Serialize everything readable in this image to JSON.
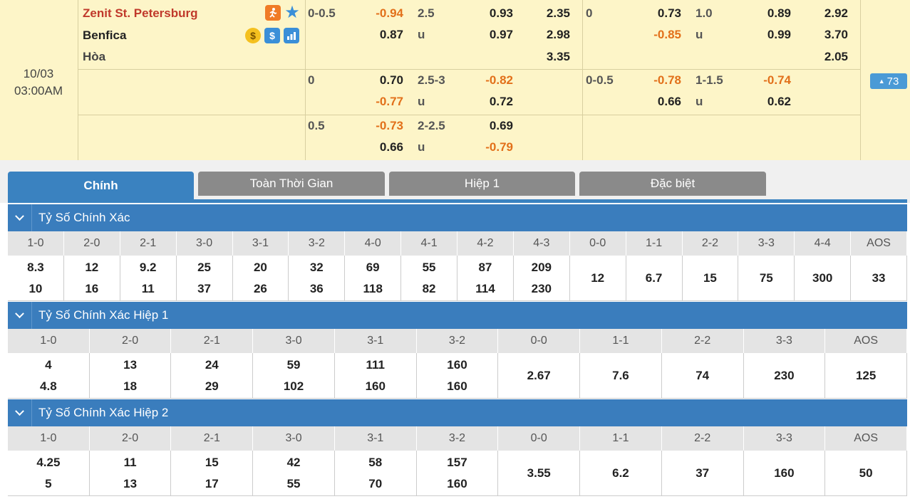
{
  "match": {
    "date": "10/03",
    "time": "03:00AM",
    "home": "Zenit St. Petersburg",
    "away": "Benfica",
    "draw": "Hòa",
    "more_count": "73",
    "icons": [
      "live-icon",
      "star-icon",
      "coin-icon",
      "dollar-icon",
      "stats-icon"
    ],
    "rows": [
      {
        "ft_hdp_line": "0-0.5",
        "ft_hdp_home": "-0.94",
        "ft_hdp_away": "0.87",
        "ft_ou_line": "2.5",
        "ft_ou_u": "u",
        "ft_ou_over": "0.93",
        "ft_ou_under": "0.97",
        "ft_1x2": [
          "2.35",
          "2.98",
          "3.35"
        ],
        "h1_hdp_line": "0",
        "h1_hdp_home": "0.73",
        "h1_hdp_away": "-0.85",
        "h1_ou_line": "1.0",
        "h1_ou_u": "u",
        "h1_ou_over": "0.89",
        "h1_ou_under": "0.99",
        "h1_1x2": [
          "2.92",
          "3.70",
          "2.05"
        ]
      },
      {
        "ft_hdp_line": "0",
        "ft_hdp_home": "0.70",
        "ft_hdp_away": "-0.77",
        "ft_ou_line": "2.5-3",
        "ft_ou_u": "u",
        "ft_ou_over": "-0.82",
        "ft_ou_under": "0.72",
        "h1_hdp_line": "0-0.5",
        "h1_hdp_home": "-0.78",
        "h1_hdp_away": "0.66",
        "h1_ou_line": "1-1.5",
        "h1_ou_u": "u",
        "h1_ou_over": "-0.74",
        "h1_ou_under": "0.62"
      },
      {
        "ft_hdp_line": "0.5",
        "ft_hdp_home": "-0.73",
        "ft_hdp_away": "0.66",
        "ft_ou_line": "2-2.5",
        "ft_ou_u": "u",
        "ft_ou_over": "0.69",
        "ft_ou_under": "-0.79"
      }
    ]
  },
  "tabs": [
    "Chính",
    "Toàn Thời Gian",
    "Hiệp 1",
    "Đặc biệt"
  ],
  "sections": [
    {
      "title": "Tỷ Số Chính Xác",
      "headers": [
        "1-0",
        "2-0",
        "2-1",
        "3-0",
        "3-1",
        "3-2",
        "4-0",
        "4-1",
        "4-2",
        "4-3",
        "0-0",
        "1-1",
        "2-2",
        "3-3",
        "4-4",
        "AOS"
      ],
      "cells": [
        [
          "8.3",
          "10"
        ],
        [
          "12",
          "16"
        ],
        [
          "9.2",
          "11"
        ],
        [
          "25",
          "37"
        ],
        [
          "20",
          "26"
        ],
        [
          "32",
          "36"
        ],
        [
          "69",
          "118"
        ],
        [
          "55",
          "82"
        ],
        [
          "87",
          "114"
        ],
        [
          "209",
          "230"
        ],
        [
          "12"
        ],
        [
          "6.7"
        ],
        [
          "15"
        ],
        [
          "75"
        ],
        [
          "300"
        ],
        [
          "33"
        ]
      ]
    },
    {
      "title": "Tỷ Số Chính Xác Hiệp 1",
      "headers": [
        "1-0",
        "2-0",
        "2-1",
        "3-0",
        "3-1",
        "3-2",
        "0-0",
        "1-1",
        "2-2",
        "3-3",
        "AOS"
      ],
      "cells": [
        [
          "4",
          "4.8"
        ],
        [
          "13",
          "18"
        ],
        [
          "24",
          "29"
        ],
        [
          "59",
          "102"
        ],
        [
          "111",
          "160"
        ],
        [
          "160",
          "160"
        ],
        [
          "2.67"
        ],
        [
          "7.6"
        ],
        [
          "74"
        ],
        [
          "230"
        ],
        [
          "125"
        ]
      ]
    },
    {
      "title": "Tỷ Số Chính Xác Hiệp 2",
      "headers": [
        "1-0",
        "2-0",
        "2-1",
        "3-0",
        "3-1",
        "3-2",
        "0-0",
        "1-1",
        "2-2",
        "3-3",
        "AOS"
      ],
      "cells": [
        [
          "4.25",
          "5"
        ],
        [
          "11",
          "13"
        ],
        [
          "15",
          "17"
        ],
        [
          "42",
          "55"
        ],
        [
          "58",
          "70"
        ],
        [
          "157",
          "160"
        ],
        [
          "3.55"
        ],
        [
          "6.2"
        ],
        [
          "37"
        ],
        [
          "160"
        ],
        [
          "50"
        ]
      ]
    }
  ]
}
